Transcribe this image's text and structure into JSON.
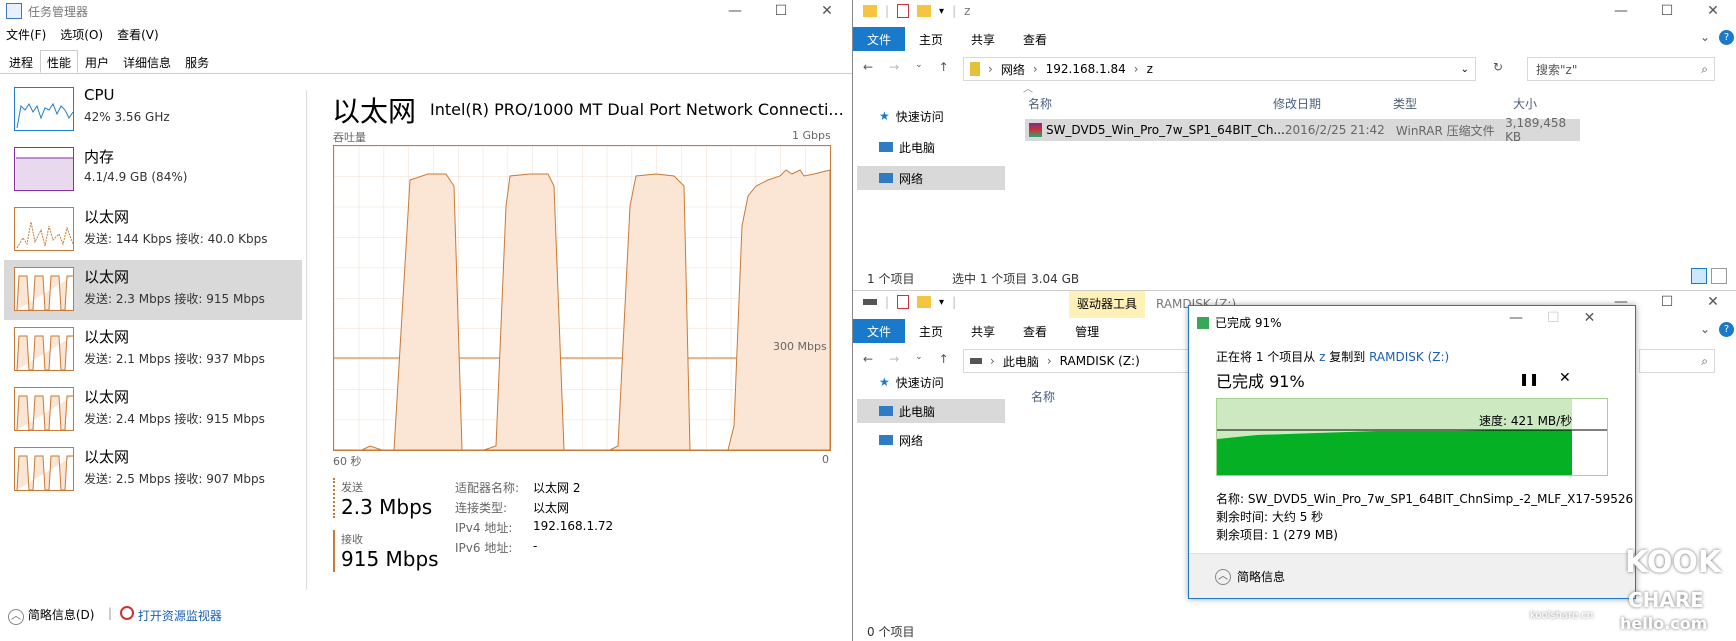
{
  "task_manager": {
    "title": "任务管理器",
    "menu": [
      "文件(F)",
      "选项(O)",
      "查看(V)"
    ],
    "tabs": [
      "进程",
      "性能",
      "用户",
      "详细信息",
      "服务"
    ],
    "active_tab": "性能",
    "side_items": [
      {
        "name": "CPU",
        "sub": "42%  3.56 GHz",
        "kind": "cpu"
      },
      {
        "name": "内存",
        "sub": "4.1/4.9 GB (84%)",
        "kind": "mem"
      },
      {
        "name": "以太网",
        "sub": "发送: 144 Kbps  接收: 40.0 Kbps",
        "kind": "eth"
      },
      {
        "name": "以太网",
        "sub": "发送: 2.3 Mbps  接收: 915 Mbps",
        "kind": "eth"
      },
      {
        "name": "以太网",
        "sub": "发送: 2.1 Mbps  接收: 937 Mbps",
        "kind": "eth"
      },
      {
        "name": "以太网",
        "sub": "发送: 2.4 Mbps  接收: 915 Mbps",
        "kind": "eth"
      },
      {
        "name": "以太网",
        "sub": "发送: 2.5 Mbps  接收: 907 Mbps",
        "kind": "eth"
      }
    ],
    "main": {
      "heading": "以太网",
      "adapter": "Intel(R) PRO/1000 MT Dual Port Network Connecti...",
      "throughput_label": "吞吐量",
      "max_label": "1 Gbps",
      "mid_label": "300 Mbps",
      "time_left": "60 秒",
      "time_right": "0",
      "send_label": "发送",
      "send_value": "2.3 Mbps",
      "recv_label": "接收",
      "recv_value": "915 Mbps",
      "details": [
        {
          "k": "适配器名称:",
          "v": "以太网 2"
        },
        {
          "k": "连接类型:",
          "v": "以太网"
        },
        {
          "k": "IPv4 地址:",
          "v": "192.168.1.72"
        },
        {
          "k": "IPv6 地址:",
          "v": "-"
        }
      ]
    },
    "footer": {
      "brief": "简略信息(D)",
      "monitor": "打开资源监视器"
    }
  },
  "explorer_top": {
    "title": "z",
    "ribbon": [
      "文件",
      "主页",
      "共享",
      "查看"
    ],
    "address": [
      "网络",
      "192.168.1.84",
      "z"
    ],
    "search_placeholder": "搜索\"z\"",
    "nav": [
      "快速访问",
      "此电脑",
      "网络"
    ],
    "selected_nav": "网络",
    "columns": [
      "名称",
      "修改日期",
      "类型",
      "大小"
    ],
    "row": {
      "name": "SW_DVD5_Win_Pro_7w_SP1_64BIT_Ch...",
      "date": "2016/2/25 21:42",
      "type": "WinRAR 压缩文件",
      "size": "3,189,458 KB"
    },
    "status": {
      "count": "1 个项目",
      "selected": "选中 1 个项目  3.04 GB"
    }
  },
  "explorer_bottom": {
    "title": "RAMDISK (Z:)",
    "drive_tools": "驱动器工具",
    "ribbon": [
      "文件",
      "主页",
      "共享",
      "查看",
      "管理"
    ],
    "address": [
      "此电脑",
      "RAMDISK (Z:)"
    ],
    "nav": [
      "快速访问",
      "此电脑",
      "网络"
    ],
    "selected_nav": "此电脑",
    "columns": [
      "名称"
    ],
    "status": {
      "count": "0 个项目"
    }
  },
  "copy_dialog": {
    "title": "已完成 91%",
    "line1_prefix": "正在将 1 个项目从",
    "from": "z",
    "line1_mid": "复制到",
    "to": "RAMDISK (Z:)",
    "progress_text": "已完成 91%",
    "progress": 0.91,
    "speed": "速度: 421 MB/秒",
    "name_label": "名称:",
    "name_value": "SW_DVD5_Win_Pro_7w_SP1_64BIT_ChnSimp_-2_MLF_X17-59526",
    "time_label": "剩余时间:",
    "time_value": "大约 5 秒",
    "items_label": "剩余项目:",
    "items_value": "1 (279 MB)",
    "brief": "简略信息"
  },
  "watermark": {
    "top": "KOOK",
    "bottom": "CHARE",
    "url": "koolshare.cn",
    "site": "hello.com"
  },
  "colors": {
    "eth": "#c97a35",
    "cpu": "#1e7fc8",
    "mem": "#8b2ea4",
    "accent": "#1979ca",
    "copy_green": "#06b025"
  }
}
